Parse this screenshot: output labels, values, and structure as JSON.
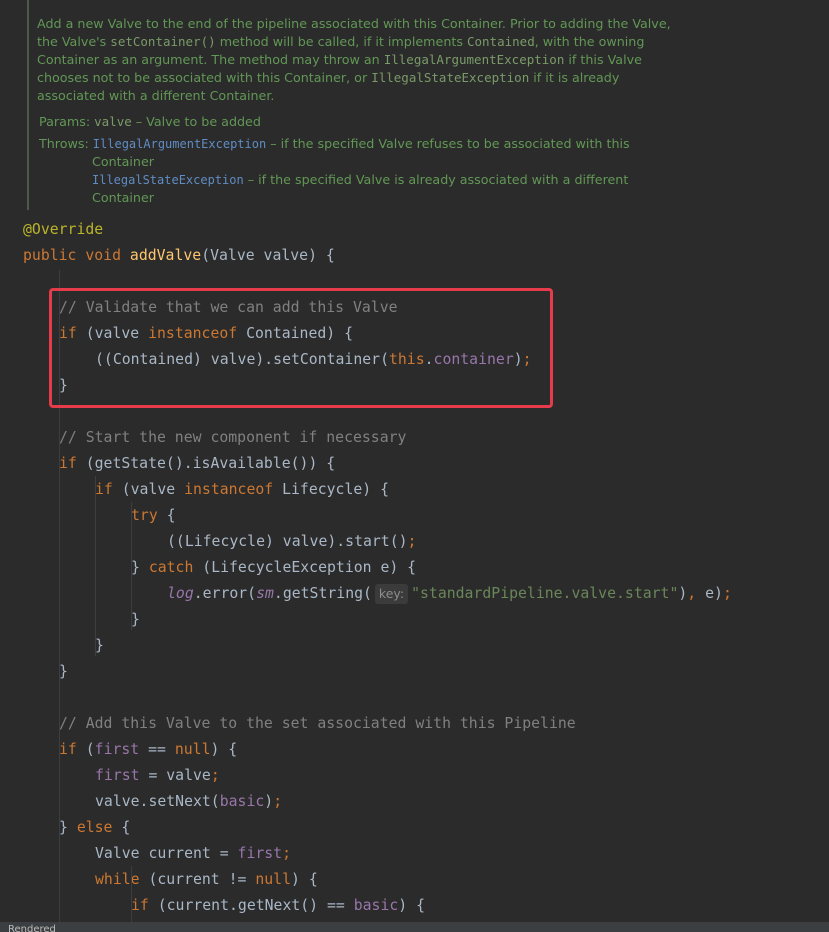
{
  "doc": {
    "lines": [
      [
        {
          "t": "Add a new Valve to the end of the pipeline associated with this Container. Prior to adding the Valve,",
          "c": "text"
        }
      ],
      [
        {
          "t": "the Valve's ",
          "c": "text"
        },
        {
          "t": "setContainer()",
          "c": "mono"
        },
        {
          "t": " method will be called, if it implements ",
          "c": "text"
        },
        {
          "t": "Contained",
          "c": "mono"
        },
        {
          "t": ", with the owning",
          "c": "text"
        }
      ],
      [
        {
          "t": "Container as an argument. The method may throw an ",
          "c": "text"
        },
        {
          "t": "IllegalArgumentException",
          "c": "mono"
        },
        {
          "t": " if this Valve",
          "c": "text"
        }
      ],
      [
        {
          "t": "chooses not to be associated with this Container, or ",
          "c": "text"
        },
        {
          "t": "IllegalStateException",
          "c": "mono"
        },
        {
          "t": " if it is already",
          "c": "text"
        }
      ],
      [
        {
          "t": "associated with a different Container.",
          "c": "text"
        }
      ]
    ],
    "params_label": "Params:",
    "params_name": "valve",
    "params_desc": " – Valve to be added",
    "throws_label": "Throws:",
    "throws": [
      {
        "exc": "IllegalArgumentException",
        "desc": " – if the specified Valve refuses to be associated with this",
        "cont": "Container"
      },
      {
        "exc": "IllegalStateException",
        "desc": " – if the specified Valve is already associated with a different",
        "cont": "Container"
      }
    ]
  },
  "code": {
    "lines": [
      {
        "i": 0,
        "tok": [
          {
            "t": "@Override",
            "c": "ann"
          }
        ]
      },
      {
        "i": 0,
        "tok": [
          {
            "t": "public ",
            "c": "kw"
          },
          {
            "t": "void ",
            "c": "kw"
          },
          {
            "t": "addValve",
            "c": "fn"
          },
          {
            "t": "(Valve valve) {",
            "c": "p"
          }
        ]
      },
      {
        "i": 0,
        "tok": []
      },
      {
        "i": 1,
        "tok": [
          {
            "t": "// Validate that we can add this Valve",
            "c": "cmt"
          }
        ]
      },
      {
        "i": 1,
        "tok": [
          {
            "t": "if ",
            "c": "kw"
          },
          {
            "t": "(valve ",
            "c": "p"
          },
          {
            "t": "instanceof ",
            "c": "kw"
          },
          {
            "t": "Contained) {",
            "c": "p"
          }
        ]
      },
      {
        "i": 2,
        "tok": [
          {
            "t": "((Contained) valve).setContainer(",
            "c": "p"
          },
          {
            "t": "this",
            "c": "kw"
          },
          {
            "t": ".",
            "c": "p"
          },
          {
            "t": "container",
            "c": "fld"
          },
          {
            "t": ")",
            "c": "p"
          },
          {
            "t": ";",
            "c": "kw"
          }
        ]
      },
      {
        "i": 1,
        "tok": [
          {
            "t": "}",
            "c": "p"
          }
        ]
      },
      {
        "i": 0,
        "tok": []
      },
      {
        "i": 1,
        "tok": [
          {
            "t": "// Start the new component if necessary",
            "c": "cmt"
          }
        ]
      },
      {
        "i": 1,
        "tok": [
          {
            "t": "if ",
            "c": "kw"
          },
          {
            "t": "(getState().isAvailable()) {",
            "c": "p"
          }
        ]
      },
      {
        "i": 2,
        "tok": [
          {
            "t": "if ",
            "c": "kw"
          },
          {
            "t": "(valve ",
            "c": "p"
          },
          {
            "t": "instanceof ",
            "c": "kw"
          },
          {
            "t": "Lifecycle) {",
            "c": "p"
          }
        ]
      },
      {
        "i": 3,
        "tok": [
          {
            "t": "try ",
            "c": "kw"
          },
          {
            "t": "{",
            "c": "p"
          }
        ]
      },
      {
        "i": 4,
        "tok": [
          {
            "t": "((Lifecycle) valve).start()",
            "c": "p"
          },
          {
            "t": ";",
            "c": "kw"
          }
        ]
      },
      {
        "i": 3,
        "tok": [
          {
            "t": "} ",
            "c": "p"
          },
          {
            "t": "catch ",
            "c": "kw"
          },
          {
            "t": "(LifecycleException e) {",
            "c": "p"
          }
        ]
      },
      {
        "i": 4,
        "tok": [
          {
            "t": "log",
            "c": "st"
          },
          {
            "t": ".error(",
            "c": "p"
          },
          {
            "t": "sm",
            "c": "st"
          },
          {
            "t": ".getString(",
            "c": "p"
          },
          {
            "t": "key:",
            "c": "hint"
          },
          {
            "t": "\"standardPipeline.valve.start\"",
            "c": "str"
          },
          {
            "t": ")",
            "c": "p"
          },
          {
            "t": ", ",
            "c": "kw"
          },
          {
            "t": "e)",
            "c": "p"
          },
          {
            "t": ";",
            "c": "kw"
          }
        ]
      },
      {
        "i": 3,
        "tok": [
          {
            "t": "}",
            "c": "p"
          }
        ]
      },
      {
        "i": 2,
        "tok": [
          {
            "t": "}",
            "c": "p"
          }
        ]
      },
      {
        "i": 1,
        "tok": [
          {
            "t": "}",
            "c": "p"
          }
        ]
      },
      {
        "i": 0,
        "tok": []
      },
      {
        "i": 1,
        "tok": [
          {
            "t": "// Add this Valve to the set associated with this Pipeline",
            "c": "cmt"
          }
        ]
      },
      {
        "i": 1,
        "tok": [
          {
            "t": "if ",
            "c": "kw"
          },
          {
            "t": "(",
            "c": "p"
          },
          {
            "t": "first ",
            "c": "fld"
          },
          {
            "t": "== ",
            "c": "p"
          },
          {
            "t": "null",
            "c": "kw"
          },
          {
            "t": ") {",
            "c": "p"
          }
        ]
      },
      {
        "i": 2,
        "tok": [
          {
            "t": "first ",
            "c": "fld"
          },
          {
            "t": "= valve",
            "c": "p"
          },
          {
            "t": ";",
            "c": "kw"
          }
        ]
      },
      {
        "i": 2,
        "tok": [
          {
            "t": "valve.setNext(",
            "c": "p"
          },
          {
            "t": "basic",
            "c": "fld"
          },
          {
            "t": ")",
            "c": "p"
          },
          {
            "t": ";",
            "c": "kw"
          }
        ]
      },
      {
        "i": 1,
        "tok": [
          {
            "t": "} ",
            "c": "p"
          },
          {
            "t": "else ",
            "c": "kw"
          },
          {
            "t": "{",
            "c": "p"
          }
        ]
      },
      {
        "i": 2,
        "tok": [
          {
            "t": "Valve current = ",
            "c": "p"
          },
          {
            "t": "first",
            "c": "fld"
          },
          {
            "t": ";",
            "c": "kw"
          }
        ]
      },
      {
        "i": 2,
        "tok": [
          {
            "t": "while ",
            "c": "kw"
          },
          {
            "t": "(current != ",
            "c": "p"
          },
          {
            "t": "null",
            "c": "kw"
          },
          {
            "t": ") {",
            "c": "p"
          }
        ]
      },
      {
        "i": 3,
        "tok": [
          {
            "t": "if ",
            "c": "kw"
          },
          {
            "t": "(current.getNext() == ",
            "c": "p"
          },
          {
            "t": "basic",
            "c": "fld"
          },
          {
            "t": ") {",
            "c": "p"
          }
        ]
      }
    ]
  },
  "footer": {
    "label": "Rendered"
  }
}
